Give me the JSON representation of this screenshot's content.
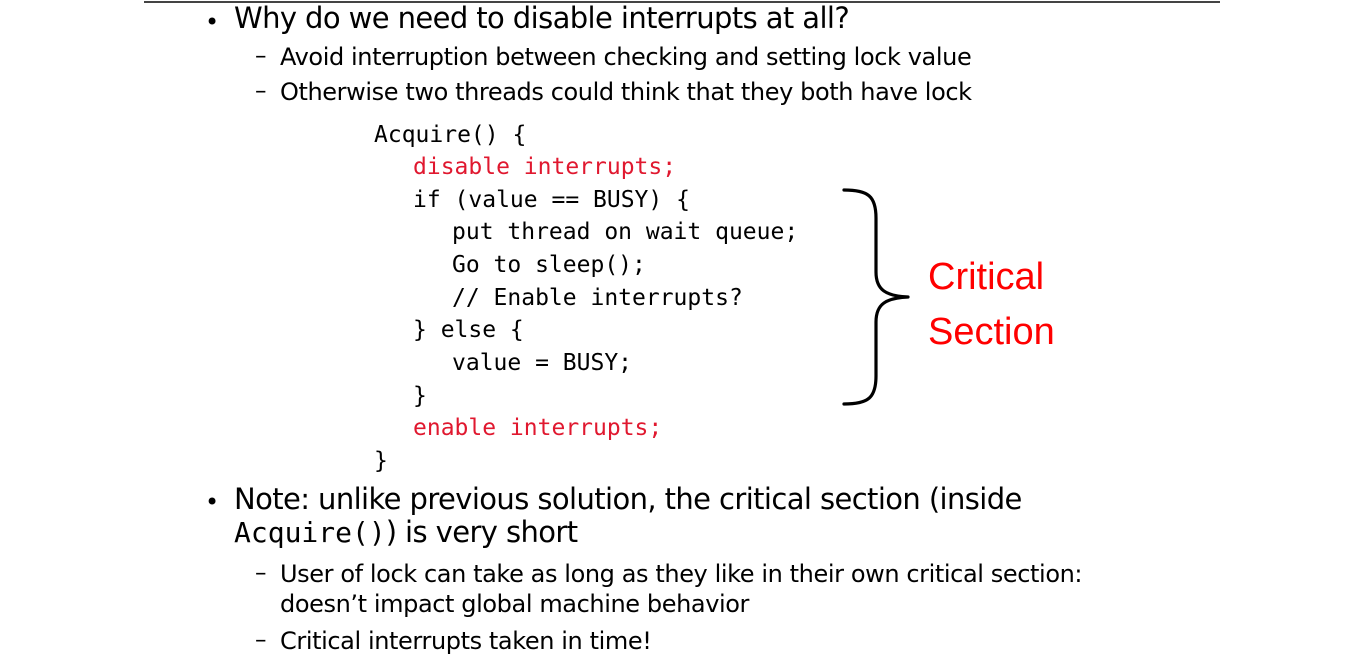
{
  "bullets": [
    {
      "text": "Why do we need to disable interrupts at all?",
      "subs": [
        "Avoid interruption between checking and setting lock value",
        "Otherwise two threads could think that they both have lock"
      ]
    },
    {
      "line1": "Note: unlike previous solution, the critical section (inside",
      "code": "Acquire()",
      "line2_rest": ") is very short",
      "subs": [
        "User of lock can take as long as they like in their own critical section:",
        "doesn’t impact global machine behavior",
        "Critical interrupts taken in time!"
      ]
    }
  ],
  "code_lines": [
    "Acquire() {",
    "disable interrupts;",
    "if (value == BUSY) {",
    "put thread on wait queue;",
    "Go to sleep();",
    "// Enable interrupts?",
    "} else {",
    "value = BUSY;",
    "}",
    "enable interrupts;",
    "}"
  ],
  "annotation": {
    "line1": "Critical",
    "line2": "Section"
  },
  "symbols": {
    "bullet": "•",
    "dash": "–"
  },
  "colors": {
    "highlight_code": "#e0182f",
    "annotation": "#ff0000"
  }
}
